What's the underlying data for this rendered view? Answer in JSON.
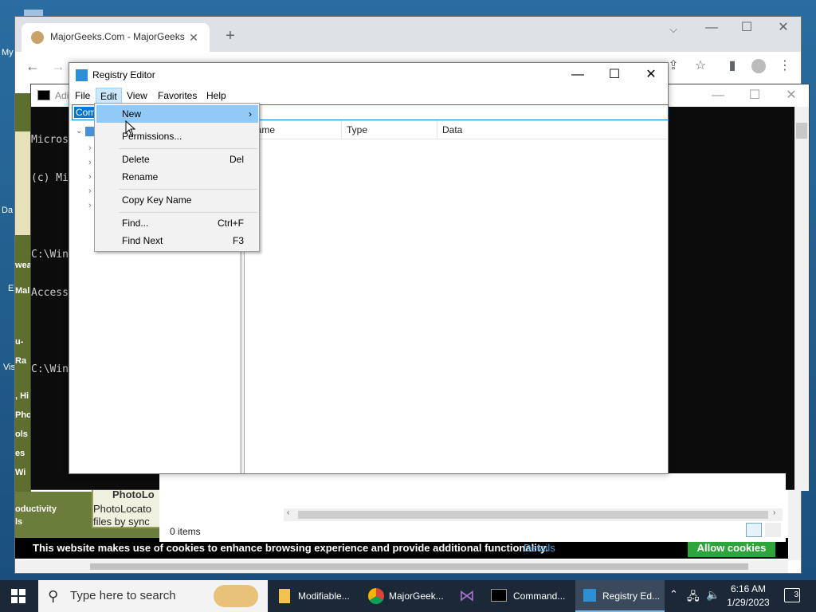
{
  "desktop": {
    "label_my": "My",
    "label_da": "Da",
    "label_vis": "Vis",
    "label_e": "E"
  },
  "chrome": {
    "tab_title": "MajorGeeks.Com - MajorGeeks",
    "cookie_text": "This website makes use of cookies to enhance browsing experience and provide additional functionality.",
    "cookie_link": "Details",
    "cookie_button": "Allow cookies",
    "side_labels": [
      "weal",
      "Mal",
      "u-Ra",
      ", Hi",
      "Pho",
      "ols",
      "es",
      "Wi"
    ],
    "bottom_labels": [
      "oductivity",
      "ls"
    ],
    "photo_title": "PhotoLo",
    "photo_line1": "PhotoLocato",
    "photo_line2": "files by sync",
    "status_items": "0 items"
  },
  "cmd": {
    "title": "Adi",
    "lines": [
      "Micros",
      "(c) Mi",
      "",
      "C:\\Win",
      "Access",
      "",
      "C:\\Win"
    ]
  },
  "regedit": {
    "title": "Registry Editor",
    "menu": [
      "File",
      "Edit",
      "View",
      "Favorites",
      "Help"
    ],
    "address_fragment": "Com",
    "columns": [
      "Name",
      "Type",
      "Data"
    ],
    "edit_menu": {
      "items": [
        {
          "label": "New",
          "shortcut": "",
          "submenu": true
        },
        {
          "label": "Permissions...",
          "shortcut": ""
        },
        {
          "label": "Delete",
          "shortcut": "Del"
        },
        {
          "label": "Rename",
          "shortcut": ""
        },
        {
          "label": "Copy Key Name",
          "shortcut": ""
        },
        {
          "label": "Find...",
          "shortcut": "Ctrl+F"
        },
        {
          "label": "Find Next",
          "shortcut": "F3"
        }
      ]
    }
  },
  "taskbar": {
    "search_placeholder": "Type here to search",
    "apps": [
      "Modifiable...",
      "MajorGeek...",
      "Command...",
      "Registry Ed..."
    ],
    "time": "6:16 AM",
    "date": "1/29/2023",
    "notification_count": "3"
  }
}
